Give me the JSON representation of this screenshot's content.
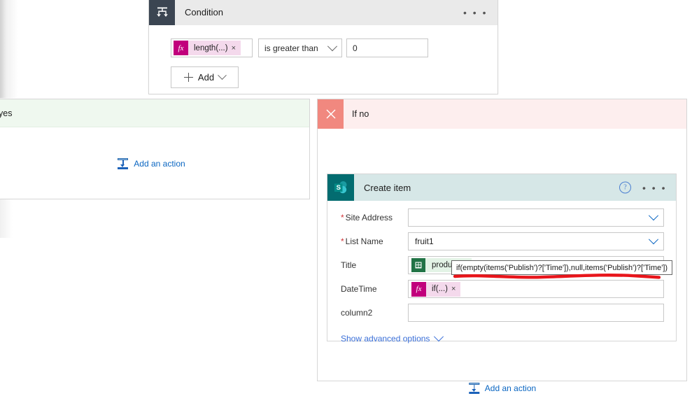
{
  "condition_card": {
    "icon": "condition-branch-icon",
    "title": "Condition",
    "menu_icon": "ellipsis-icon",
    "operand_left": {
      "icon": "fx-icon",
      "icon_label": "fx",
      "token_text": "length(...)",
      "remove_icon": "close-icon",
      "remove_label": "×"
    },
    "operator": {
      "value": "is greater than",
      "chevron_icon": "chevron-down-icon"
    },
    "operand_right_value": "0",
    "add_button": {
      "plus_icon": "plus-icon",
      "label": "Add",
      "chevron_icon": "chevron-down-icon"
    }
  },
  "yes_branch": {
    "label": "yes",
    "add_action": {
      "icon": "insert-step-icon",
      "label": "Add an action"
    }
  },
  "ifno_branch": {
    "close_icon": "close-x-icon",
    "label": "If no",
    "add_action": {
      "icon": "insert-step-icon",
      "label": "Add an action"
    },
    "create_item": {
      "icon": "sharepoint-icon",
      "icon_label": "S",
      "title": "Create item",
      "help_icon": "help-icon",
      "help_label": "?",
      "menu_icon": "ellipsis-icon",
      "fields": [
        {
          "label": "Site Address",
          "required": true,
          "type": "dropdown",
          "value": "",
          "chevron_icon": "chevron-down-icon"
        },
        {
          "label": "List Name",
          "required": true,
          "type": "dropdown",
          "value": "fruit1",
          "chevron_icon": "chevron-down-icon"
        },
        {
          "label": "Title",
          "required": false,
          "type": "token",
          "token_icon": "excel-icon",
          "token_text": "product",
          "remove_label": "×"
        },
        {
          "label": "DateTime",
          "required": false,
          "type": "token",
          "token_icon": "fx-icon",
          "token_icon_label": "fx",
          "token_text": "if(...)",
          "remove_label": "×"
        },
        {
          "label": "column2",
          "required": false,
          "type": "text",
          "value": ""
        }
      ],
      "show_advanced": {
        "label": "Show advanced options",
        "chevron_icon": "chevron-down-icon"
      }
    },
    "expression_tooltip": {
      "text": "if(empty(items('Publish')?['Time']),null,items('Publish')?['Time'])",
      "annotation": "red-underline-annotation"
    }
  },
  "colors": {
    "condition_header_bg": "#eaeaea",
    "condition_icon_bg": "#3b4552",
    "yes_header_bg": "#eff8ef",
    "ifno_header_bg": "#fdeeee",
    "ifno_x_bg": "#f1887f",
    "sharepoint_teal": "#036c70",
    "createitem_header_bg": "#d6e7e7",
    "fx_magenta": "#c1007c",
    "fx_chip_bg": "#f4d9ec",
    "excel_green": "#217346",
    "excel_chip_bg": "#e3f3e6",
    "link_blue": "#0a66c2",
    "required_red": "#d13438",
    "annotation_red": "#e8151b"
  }
}
